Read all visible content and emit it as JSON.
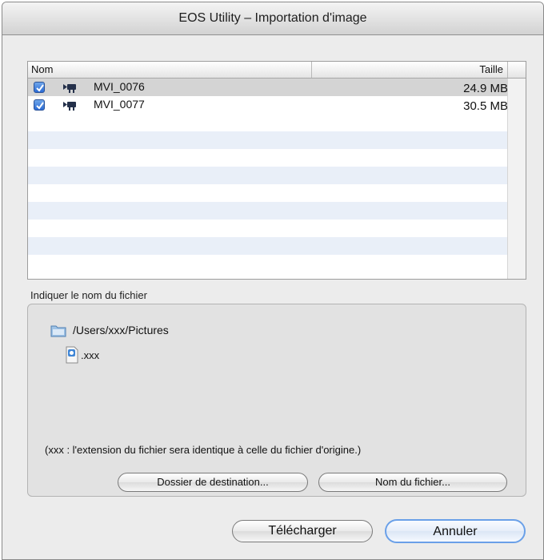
{
  "window": {
    "title": "EOS Utility – Importation d'image"
  },
  "file_list": {
    "columns": {
      "name": "Nom",
      "size": "Taille"
    },
    "rows": [
      {
        "checked": true,
        "name": "MVI_0076",
        "size": "24.9 MB",
        "selected": true
      },
      {
        "checked": true,
        "name": "MVI_0077",
        "size": "30.5 MB",
        "selected": false
      }
    ]
  },
  "filename_section": {
    "label": "Indiquer le nom du fichier",
    "path": "/Users/xxx/Pictures",
    "extension": ".xxx",
    "note": "(xxx : l'extension du fichier sera identique à celle du fichier d'origine.)",
    "destination_button": "Dossier de destination...",
    "filename_button": "Nom du fichier..."
  },
  "actions": {
    "download": "Télécharger",
    "cancel": "Annuler"
  },
  "colors": {
    "default_button_border": "#6aa0e8",
    "row_stripe": "#e9eff8",
    "selected_row": "#d4d4d4"
  },
  "icons": [
    "checkbox-checked-icon",
    "movie-camera-icon",
    "folder-icon",
    "file-icon"
  ]
}
